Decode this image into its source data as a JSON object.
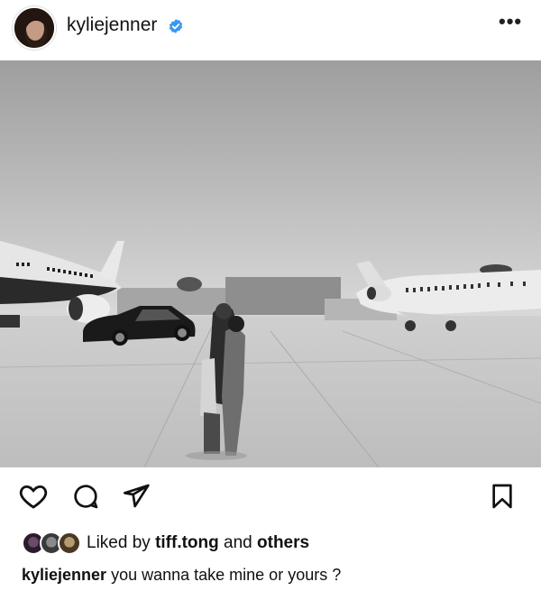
{
  "post": {
    "username": "kyliejenner",
    "more_icon": "ellipsis-icon",
    "verified_icon": "verified-badge-icon",
    "accent_verified": "#3897f0"
  },
  "photo": {
    "alt": ""
  },
  "actions": {
    "like_icon": "heart-icon",
    "comment_icon": "comment-icon",
    "share_icon": "send-icon",
    "save_icon": "bookmark-icon"
  },
  "likes": {
    "prefix": "Liked by",
    "user": "tiff.tong",
    "conjunction": "and",
    "suffix": "others"
  },
  "caption": {
    "username": "kyliejenner",
    "text": "you wanna take mine or yours ?"
  }
}
